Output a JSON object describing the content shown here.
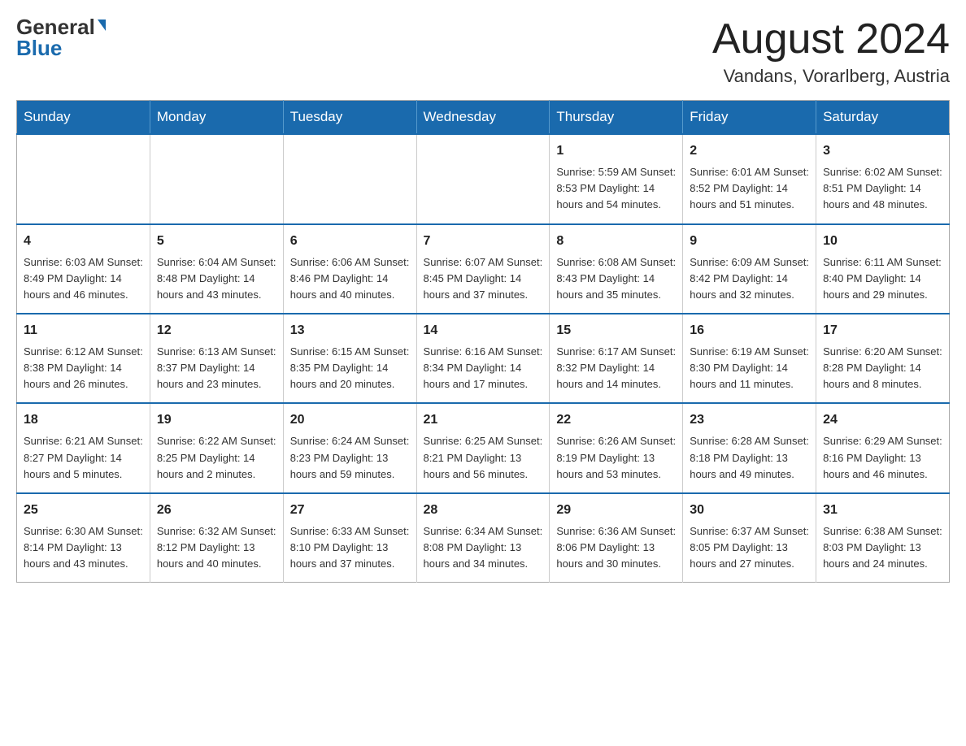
{
  "logo": {
    "general": "General",
    "blue": "Blue"
  },
  "header": {
    "month": "August 2024",
    "location": "Vandans, Vorarlberg, Austria"
  },
  "days_of_week": [
    "Sunday",
    "Monday",
    "Tuesday",
    "Wednesday",
    "Thursday",
    "Friday",
    "Saturday"
  ],
  "weeks": [
    [
      {
        "day": "",
        "info": ""
      },
      {
        "day": "",
        "info": ""
      },
      {
        "day": "",
        "info": ""
      },
      {
        "day": "",
        "info": ""
      },
      {
        "day": "1",
        "info": "Sunrise: 5:59 AM\nSunset: 8:53 PM\nDaylight: 14 hours\nand 54 minutes."
      },
      {
        "day": "2",
        "info": "Sunrise: 6:01 AM\nSunset: 8:52 PM\nDaylight: 14 hours\nand 51 minutes."
      },
      {
        "day": "3",
        "info": "Sunrise: 6:02 AM\nSunset: 8:51 PM\nDaylight: 14 hours\nand 48 minutes."
      }
    ],
    [
      {
        "day": "4",
        "info": "Sunrise: 6:03 AM\nSunset: 8:49 PM\nDaylight: 14 hours\nand 46 minutes."
      },
      {
        "day": "5",
        "info": "Sunrise: 6:04 AM\nSunset: 8:48 PM\nDaylight: 14 hours\nand 43 minutes."
      },
      {
        "day": "6",
        "info": "Sunrise: 6:06 AM\nSunset: 8:46 PM\nDaylight: 14 hours\nand 40 minutes."
      },
      {
        "day": "7",
        "info": "Sunrise: 6:07 AM\nSunset: 8:45 PM\nDaylight: 14 hours\nand 37 minutes."
      },
      {
        "day": "8",
        "info": "Sunrise: 6:08 AM\nSunset: 8:43 PM\nDaylight: 14 hours\nand 35 minutes."
      },
      {
        "day": "9",
        "info": "Sunrise: 6:09 AM\nSunset: 8:42 PM\nDaylight: 14 hours\nand 32 minutes."
      },
      {
        "day": "10",
        "info": "Sunrise: 6:11 AM\nSunset: 8:40 PM\nDaylight: 14 hours\nand 29 minutes."
      }
    ],
    [
      {
        "day": "11",
        "info": "Sunrise: 6:12 AM\nSunset: 8:38 PM\nDaylight: 14 hours\nand 26 minutes."
      },
      {
        "day": "12",
        "info": "Sunrise: 6:13 AM\nSunset: 8:37 PM\nDaylight: 14 hours\nand 23 minutes."
      },
      {
        "day": "13",
        "info": "Sunrise: 6:15 AM\nSunset: 8:35 PM\nDaylight: 14 hours\nand 20 minutes."
      },
      {
        "day": "14",
        "info": "Sunrise: 6:16 AM\nSunset: 8:34 PM\nDaylight: 14 hours\nand 17 minutes."
      },
      {
        "day": "15",
        "info": "Sunrise: 6:17 AM\nSunset: 8:32 PM\nDaylight: 14 hours\nand 14 minutes."
      },
      {
        "day": "16",
        "info": "Sunrise: 6:19 AM\nSunset: 8:30 PM\nDaylight: 14 hours\nand 11 minutes."
      },
      {
        "day": "17",
        "info": "Sunrise: 6:20 AM\nSunset: 8:28 PM\nDaylight: 14 hours\nand 8 minutes."
      }
    ],
    [
      {
        "day": "18",
        "info": "Sunrise: 6:21 AM\nSunset: 8:27 PM\nDaylight: 14 hours\nand 5 minutes."
      },
      {
        "day": "19",
        "info": "Sunrise: 6:22 AM\nSunset: 8:25 PM\nDaylight: 14 hours\nand 2 minutes."
      },
      {
        "day": "20",
        "info": "Sunrise: 6:24 AM\nSunset: 8:23 PM\nDaylight: 13 hours\nand 59 minutes."
      },
      {
        "day": "21",
        "info": "Sunrise: 6:25 AM\nSunset: 8:21 PM\nDaylight: 13 hours\nand 56 minutes."
      },
      {
        "day": "22",
        "info": "Sunrise: 6:26 AM\nSunset: 8:19 PM\nDaylight: 13 hours\nand 53 minutes."
      },
      {
        "day": "23",
        "info": "Sunrise: 6:28 AM\nSunset: 8:18 PM\nDaylight: 13 hours\nand 49 minutes."
      },
      {
        "day": "24",
        "info": "Sunrise: 6:29 AM\nSunset: 8:16 PM\nDaylight: 13 hours\nand 46 minutes."
      }
    ],
    [
      {
        "day": "25",
        "info": "Sunrise: 6:30 AM\nSunset: 8:14 PM\nDaylight: 13 hours\nand 43 minutes."
      },
      {
        "day": "26",
        "info": "Sunrise: 6:32 AM\nSunset: 8:12 PM\nDaylight: 13 hours\nand 40 minutes."
      },
      {
        "day": "27",
        "info": "Sunrise: 6:33 AM\nSunset: 8:10 PM\nDaylight: 13 hours\nand 37 minutes."
      },
      {
        "day": "28",
        "info": "Sunrise: 6:34 AM\nSunset: 8:08 PM\nDaylight: 13 hours\nand 34 minutes."
      },
      {
        "day": "29",
        "info": "Sunrise: 6:36 AM\nSunset: 8:06 PM\nDaylight: 13 hours\nand 30 minutes."
      },
      {
        "day": "30",
        "info": "Sunrise: 6:37 AM\nSunset: 8:05 PM\nDaylight: 13 hours\nand 27 minutes."
      },
      {
        "day": "31",
        "info": "Sunrise: 6:38 AM\nSunset: 8:03 PM\nDaylight: 13 hours\nand 24 minutes."
      }
    ]
  ]
}
